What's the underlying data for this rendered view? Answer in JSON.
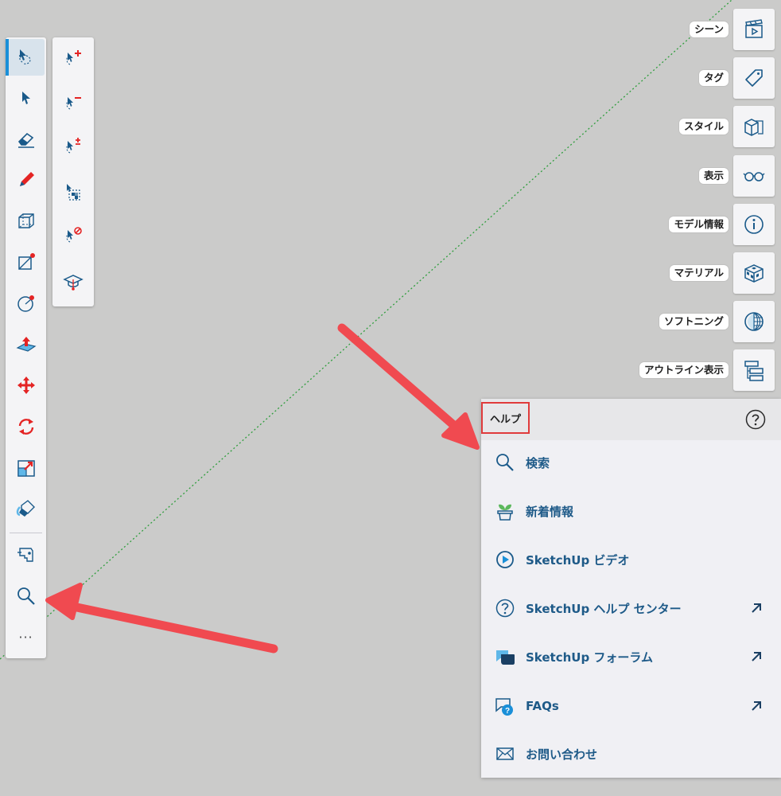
{
  "colors": {
    "canvas": "#cbcbca",
    "accent": "#1a8fd8",
    "tool_blue": "#1a5a8a",
    "tool_red": "#e42424",
    "annotation_red": "#f04a50",
    "axis_green": "#2e9d3c"
  },
  "main_toolbar": {
    "tools": [
      {
        "icon": "select-tool-icon",
        "active": true
      },
      {
        "icon": "select-arrow-icon"
      },
      {
        "icon": "eraser-icon"
      },
      {
        "icon": "pencil-icon"
      },
      {
        "icon": "box-icon"
      },
      {
        "icon": "rectangle-icon"
      },
      {
        "icon": "circle-icon"
      },
      {
        "icon": "push-pull-icon"
      },
      {
        "icon": "move-icon"
      },
      {
        "icon": "rotate-icon"
      },
      {
        "icon": "scale-icon"
      },
      {
        "icon": "paint-bucket-icon"
      },
      {
        "icon": "tape-measure-icon"
      },
      {
        "icon": "search-icon"
      }
    ],
    "more_label": "···"
  },
  "sub_toolbar": {
    "tools": [
      {
        "icon": "select-add-icon"
      },
      {
        "icon": "select-subtract-icon"
      },
      {
        "icon": "select-toggle-icon"
      },
      {
        "icon": "select-all-icon"
      },
      {
        "icon": "select-none-icon"
      },
      {
        "icon": "instructor-icon"
      }
    ]
  },
  "tray": {
    "items": [
      {
        "label": "シーン",
        "icon": "scenes-icon"
      },
      {
        "label": "タグ",
        "icon": "tag-icon"
      },
      {
        "label": "スタイル",
        "icon": "styles-icon"
      },
      {
        "label": "表示",
        "icon": "glasses-icon"
      },
      {
        "label": "モデル情報",
        "icon": "info-icon"
      },
      {
        "label": "マテリアル",
        "icon": "materials-icon"
      },
      {
        "label": "ソフトニング",
        "icon": "soften-icon"
      },
      {
        "label": "アウトライン表示",
        "icon": "outliner-icon"
      }
    ]
  },
  "help_panel": {
    "title": "ヘルプ",
    "items": [
      {
        "label": "検索",
        "icon": "search-icon",
        "external": false
      },
      {
        "label": "新着情報",
        "icon": "sprout-icon",
        "external": false
      },
      {
        "label": "SketchUp ビデオ",
        "icon": "video-play-icon",
        "external": false
      },
      {
        "label": "SketchUp ヘルプ センター",
        "icon": "help-circle-icon",
        "external": true
      },
      {
        "label": "SketchUp フォーラム",
        "icon": "forum-icon",
        "external": true
      },
      {
        "label": "FAQs",
        "icon": "faq-icon",
        "external": true
      },
      {
        "label": "お問い合わせ",
        "icon": "mail-icon",
        "external": false
      }
    ]
  }
}
